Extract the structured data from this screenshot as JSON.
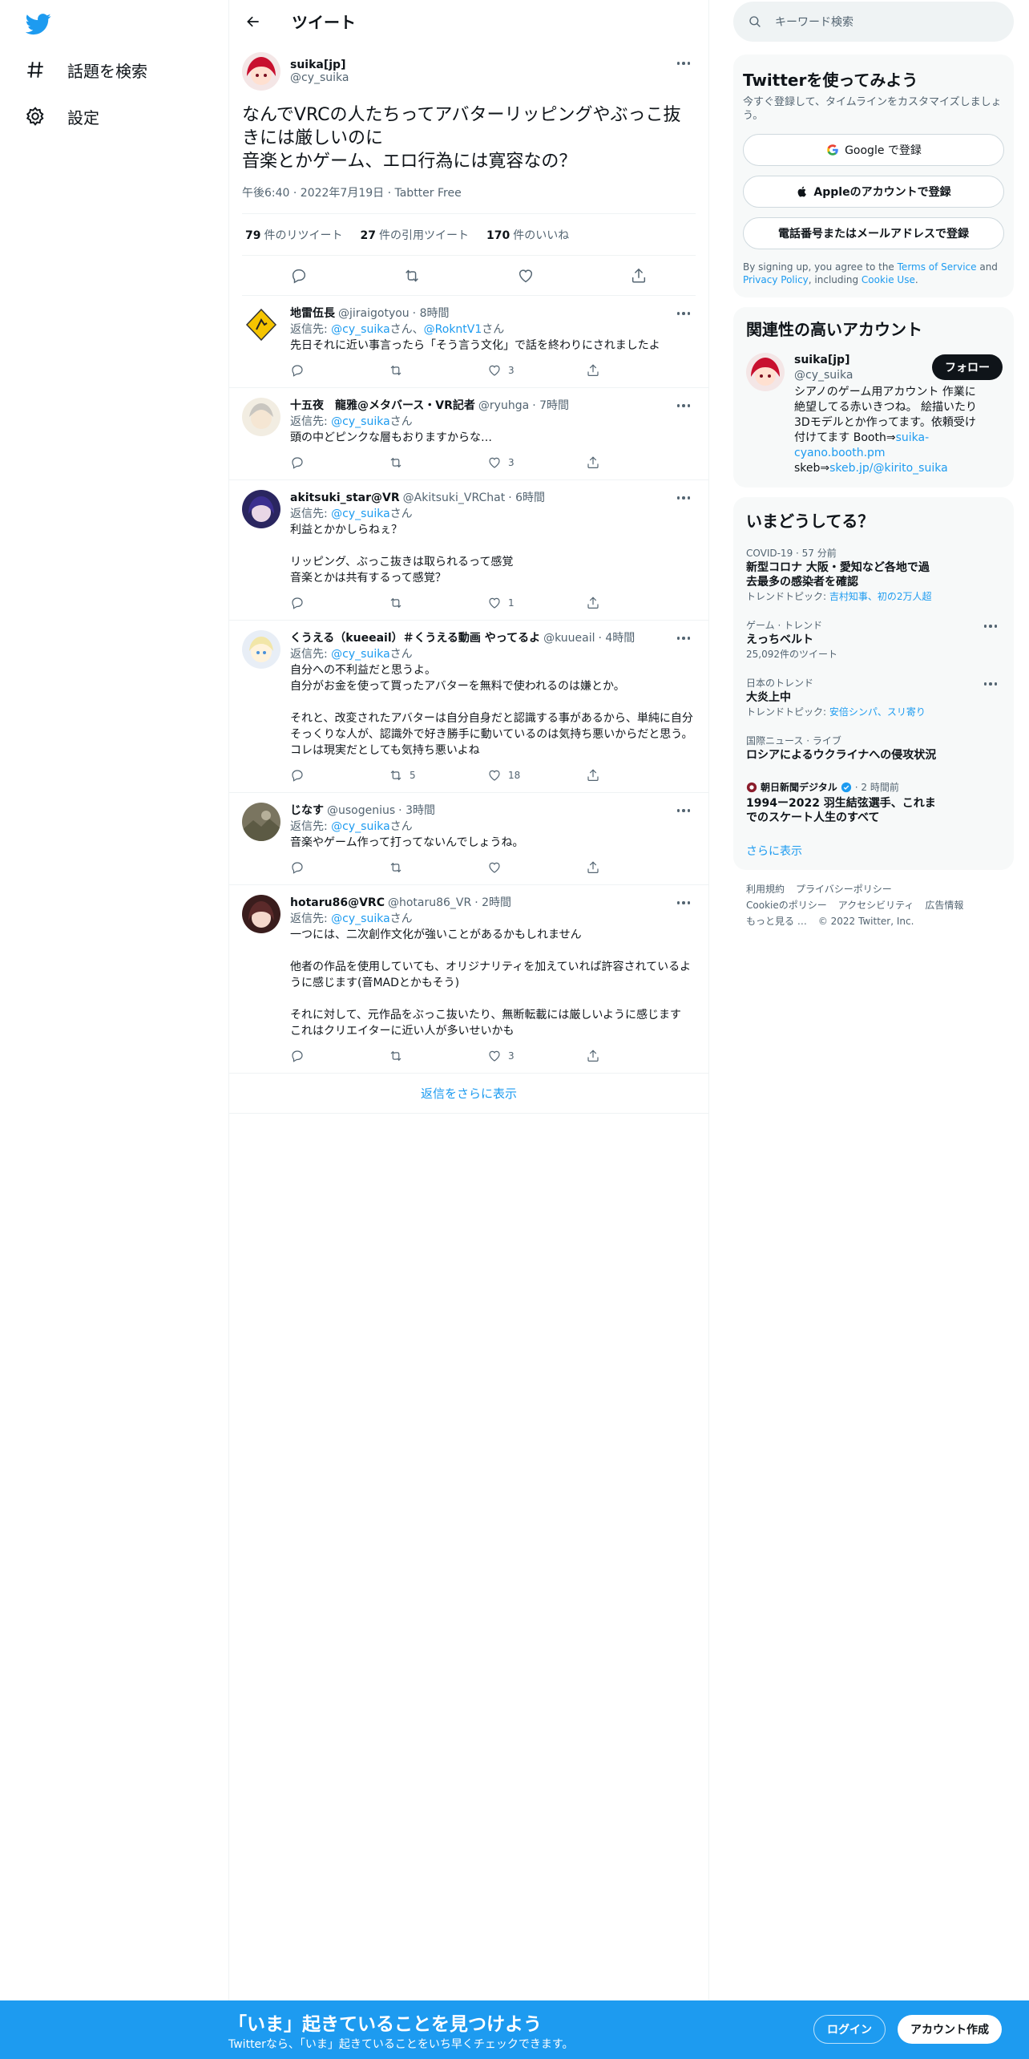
{
  "nav": {
    "explore_label": "話題を検索",
    "settings_label": "設定"
  },
  "header": {
    "title": "ツイート"
  },
  "focal": {
    "name": "suika[jp]",
    "handle": "@cy_suika",
    "text": "なんでVRCの人たちってアバターリッピングやぶっこ抜きには厳しいのに\n音楽とかゲーム、エロ行為には寛容なの？",
    "meta": "午後6:40 · 2022年7月19日 · Tabtter Free",
    "retweets_count": "79",
    "retweets_label": "件のリツイート",
    "quotes_count": "27",
    "quotes_label": "件の引用ツイート",
    "likes_count": "170",
    "likes_label": "件のいいね"
  },
  "replies": [
    {
      "name": "地雷伍長",
      "handle": "@jiraigotyou",
      "time": "· 8時間",
      "reply_prefix": "返信先: ",
      "reply_to": "@cy_suika",
      "reply_mid": "さん、",
      "reply_to2": "@RokntV1",
      "reply_suffix": "さん",
      "text": "先日それに近い事言ったら「そう言う文化」で話を終わりにされましたよ",
      "replies": "",
      "retweets": "",
      "likes": "3"
    },
    {
      "name": "十五夜　龍雅@メタバース・VR記者",
      "handle": "@ryuhga",
      "time": "· 7時間",
      "reply_prefix": "返信先: ",
      "reply_to": "@cy_suika",
      "reply_suffix": "さん",
      "text": "頭の中どピンクな層もおりますからな…",
      "replies": "",
      "retweets": "",
      "likes": "3"
    },
    {
      "name": "akitsuki_star@VR",
      "handle": "@Akitsuki_VRChat",
      "time": "· 6時間",
      "reply_prefix": "返信先: ",
      "reply_to": "@cy_suika",
      "reply_suffix": "さん",
      "text": "利益とかかしらねぇ？\n\nリッピング、ぶっこ抜きは取られるって感覚\n音楽とかは共有するって感覚？",
      "replies": "",
      "retweets": "",
      "likes": "1"
    },
    {
      "name": "くうえる（kueeail）＃くうえる動画 やってるよ",
      "handle": "@kuueail",
      "time": "· 4時間",
      "reply_prefix": "返信先: ",
      "reply_to": "@cy_suika",
      "reply_suffix": "さん",
      "text": "自分への不利益だと思うよ。\n自分がお金を使って買ったアバターを無料で使われるのは嫌とか。\n\nそれと、改変されたアバターは自分自身だと認識する事があるから、単純に自分そっくりな人が、認識外で好き勝手に動いているのは気持ち悪いからだと思う。\nコレは現実だとしても気持ち悪いよね",
      "replies": "",
      "retweets": "5",
      "likes": "18"
    },
    {
      "name": "じなす",
      "handle": "@usogenius",
      "time": "· 3時間",
      "reply_prefix": "返信先: ",
      "reply_to": "@cy_suika",
      "reply_suffix": "さん",
      "text": "音楽やゲーム作って打ってないんでしょうね。",
      "replies": "",
      "retweets": "",
      "likes": ""
    },
    {
      "name": "hotaru86@VRC",
      "handle": "@hotaru86_VR",
      "time": "· 2時間",
      "reply_prefix": "返信先: ",
      "reply_to": "@cy_suika",
      "reply_suffix": "さん",
      "text": "一つには、二次創作文化が強いことがあるかもしれません\n\n他者の作品を使用していても、オリジナリティを加えていれば許容されているように感じます(音MADとかもそう)\n\nそれに対して、元作品をぶっこ抜いたり、無断転載には厳しいように感じます\nこれはクリエイターに近い人が多いせいかも",
      "replies": "",
      "retweets": "",
      "likes": "3"
    }
  ],
  "show_more_replies": "返信をさらに表示",
  "search": {
    "placeholder": "キーワード検索"
  },
  "signup": {
    "title": "Twitterを使ってみよう",
    "subtitle": "今すぐ登録して、タイムラインをカスタマイズしましょう。",
    "google": "Google で登録",
    "apple": "Appleのアカウントで登録",
    "phone": "電話番号またはメールアドレスで登録",
    "terms_prefix": "By signing up, you agree to the ",
    "terms_tos": "Terms of Service",
    "terms_and": " and ",
    "terms_privacy": "Privacy Policy",
    "terms_incl": ", including ",
    "terms_cookie": "Cookie Use",
    "terms_end": "."
  },
  "related": {
    "title": "関連性の高いアカウント",
    "name": "suika[jp]",
    "handle": "@cy_suika",
    "follow": "フォロー",
    "bio_1": "シアノのゲーム用アカウント 作業に絶望してる赤いきつね。 絵描いたり3Dモデルとか作ってます。依頼受け付けてます Booth⇒",
    "bio_link1": "suika-cyano.booth.pm",
    "bio_2": "skeb⇒",
    "bio_link2": "skeb.jp/@kirito_suika"
  },
  "trends": {
    "title": "いまどうしてる？",
    "items": [
      {
        "context": "COVID-19 · 57 分前",
        "title": "新型コロナ 大阪・愛知など各地で過去最多の感染者を確認",
        "topic_prefix": "トレンドトピック: ",
        "topic": "吉村知事、初の2万人超"
      },
      {
        "context": "ゲーム · トレンド",
        "title": "えっちベルト",
        "count": "25,092件のツイート"
      },
      {
        "context": "日本のトレンド",
        "title": "大炎上中",
        "topic_prefix": "トレンドトピック: ",
        "topic": "安倍シンパ、スリ寄り"
      },
      {
        "context": "国際ニュース · ライブ",
        "title": "ロシアによるウクライナへの侵攻状況"
      },
      {
        "source": "朝日新聞デジタル",
        "time": "· 2 時間前",
        "title": "1994ー2022 羽生結弦選手、これまでのスケート人生のすべて"
      }
    ],
    "show_more": "さらに表示"
  },
  "footer": {
    "terms": "利用規約",
    "privacy": "プライバシーポリシー",
    "cookie": "Cookieのポリシー",
    "accessibility": "アクセシビリティ",
    "ads": "広告情報",
    "more": "もっと見る …",
    "copyright": "© 2022 Twitter, Inc."
  },
  "bottom_bar": {
    "title": "「いま」起きていることを見つけよう",
    "subtitle": "Twitterなら、「いま」起きていることをいち早くチェックできます。",
    "login": "ログイン",
    "signup": "アカウント作成"
  },
  "colors": {
    "accent": "#1d9bf0",
    "text": "#0f1419",
    "muted": "#536471",
    "border": "#eff3f4"
  }
}
